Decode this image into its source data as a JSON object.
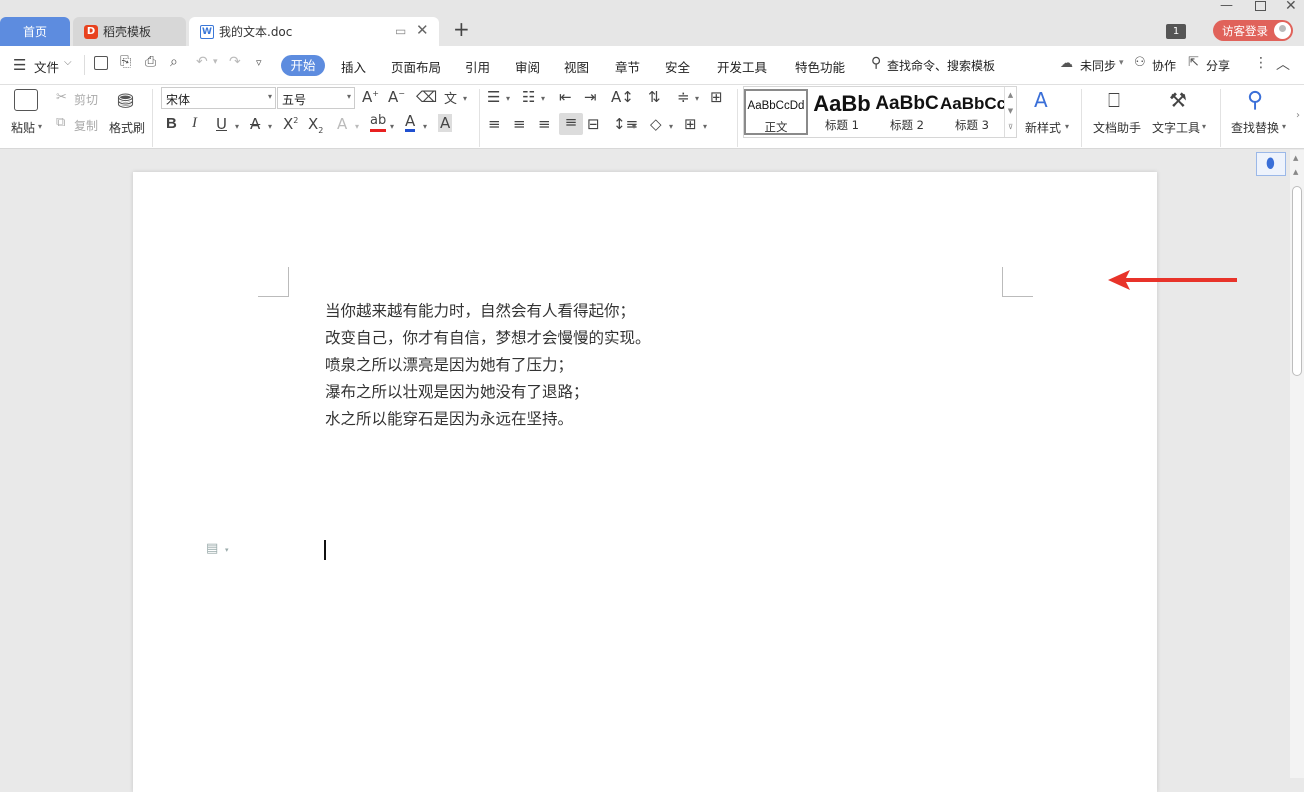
{
  "tabs": [
    {
      "label": "首页"
    },
    {
      "label": "稻壳模板"
    },
    {
      "label": "我的文本.doc"
    }
  ],
  "window": {
    "page_count_badge": "1",
    "login_label": "访客登录"
  },
  "menu": {
    "file": "文件",
    "items": [
      "开始",
      "插入",
      "页面布局",
      "引用",
      "审阅",
      "视图",
      "章节",
      "安全",
      "开发工具",
      "特色功能"
    ],
    "search_placeholder": "查找命令、搜索模板",
    "sync": "未同步",
    "collab": "协作",
    "share": "分享"
  },
  "ribbon": {
    "paste": "粘贴",
    "cut": "剪切",
    "copy": "复制",
    "format_painter": "格式刷",
    "font_name": "宋体",
    "font_size": "五号",
    "styles": [
      {
        "preview": "AaBbCcDd",
        "name": "正文"
      },
      {
        "preview": "AaBb",
        "name": "标题 1"
      },
      {
        "preview": "AaBbC",
        "name": "标题 2"
      },
      {
        "preview": "AaBbCc",
        "name": "标题 3"
      }
    ],
    "new_style": "新样式",
    "doc_assistant": "文档助手",
    "text_tools": "文字工具",
    "find_replace": "查找替换"
  },
  "document": {
    "lines": [
      "当你越来越有能力时，自然会有人看得起你；",
      "改变自己，你才有自信，梦想才会慢慢的实现。",
      "喷泉之所以漂亮是因为她有了压力；",
      "瀑布之所以壮观是因为她没有了退路；",
      "水之所以能穿石是因为永远在坚持。"
    ]
  },
  "colors": {
    "accent": "#5d8cdf",
    "login_badge": "#e0625a",
    "annotation_arrow": "#e8332a",
    "font_color_bar": "#e82020",
    "font_blue_bar": "#2050d0"
  }
}
